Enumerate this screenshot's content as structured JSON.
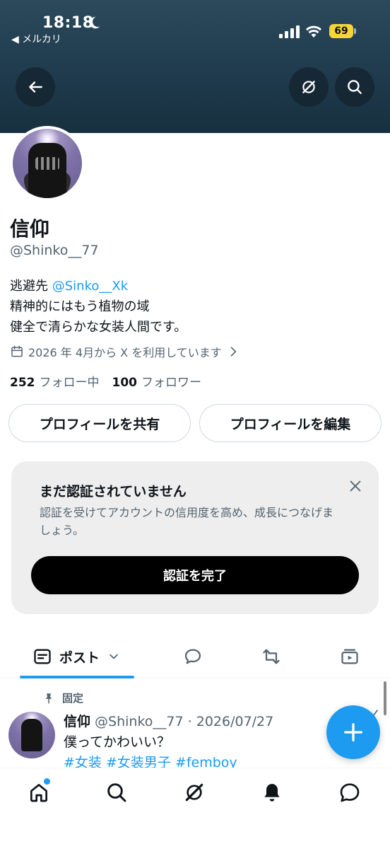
{
  "status_bar": {
    "time": "18:18",
    "back_app": "◀ メルカリ",
    "battery": "69"
  },
  "header": {
    "back_icon": "arrow-left-icon",
    "grok_icon": "grok-icon",
    "search_icon": "search-icon"
  },
  "profile": {
    "name": "信仰",
    "handle": "@Shinko__77",
    "bio_prefix": "逃避先 ",
    "bio_mention": "@Sinko__Xk",
    "bio_line2": "精神的にはもう植物の域",
    "bio_line3": "健全で清らかな女装人間です。",
    "joined": "2026 年 4月から X を利用しています",
    "following_count": "252",
    "following_label": "フォロー中",
    "followers_count": "100",
    "followers_label": "フォロワー"
  },
  "actions": {
    "share_label": "プロフィールを共有",
    "edit_label": "プロフィールを編集"
  },
  "verify": {
    "title": "まだ認証されていません",
    "description": "認証を受けてアカウントの信用度を高め、成長につなげましょう。",
    "cta": "認証を完了"
  },
  "tabs": {
    "post_label": "ポスト"
  },
  "pinned_post": {
    "pinned_label": "固定",
    "name": "信仰",
    "meta": " @Shinko__77 · 2026/07/27",
    "text": "僕ってかわいい？",
    "tags": "#女装 #女装男子 #femboy"
  },
  "colors": {
    "accent": "#1d9bf0",
    "banner": "#1f3b4d"
  }
}
